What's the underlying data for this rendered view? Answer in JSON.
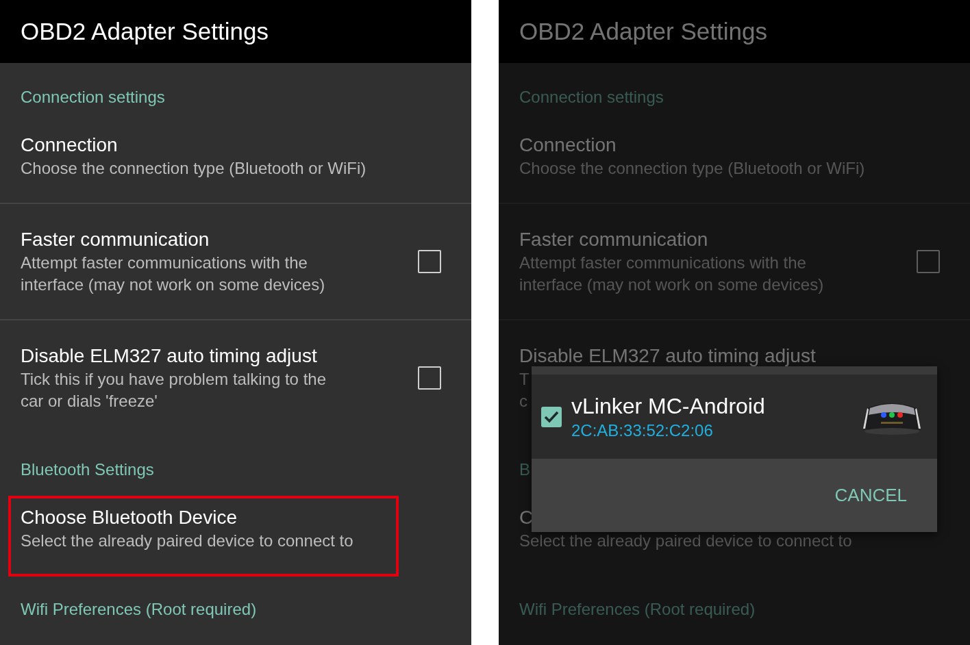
{
  "screens": [
    {
      "app_bar": {
        "title": "OBD2 Adapter Settings"
      },
      "dimmed": false,
      "sections": [
        {
          "header": "Connection settings",
          "items": [
            {
              "kind": "text",
              "title": "Connection",
              "summary": [
                "Choose the connection type (Bluetooth or WiFi)"
              ],
              "highlighted": false
            },
            {
              "kind": "checkbox",
              "title": "Faster communication",
              "summary": [
                "Attempt faster communications with the",
                "interface (may not work on some devices)"
              ],
              "checked": false,
              "highlighted": false
            },
            {
              "kind": "checkbox",
              "title": "Disable ELM327 auto timing adjust",
              "summary": [
                "Tick this if you have problem talking to the",
                "car or dials 'freeze'"
              ],
              "checked": false,
              "highlighted": false
            }
          ]
        },
        {
          "header": "Bluetooth Settings",
          "items": [
            {
              "kind": "text",
              "title": "Choose Bluetooth Device",
              "summary": [
                "Select the already paired device to connect to"
              ],
              "highlighted": true
            }
          ]
        },
        {
          "header": "Wifi Preferences (Root required)"
        }
      ]
    },
    {
      "app_bar": {
        "title": "OBD2 Adapter Settings"
      },
      "dimmed": true,
      "sections": [
        {
          "header": "Connection settings",
          "items": [
            {
              "kind": "text",
              "title": "Connection",
              "summary": [
                "Choose the connection type (Bluetooth or WiFi)"
              ],
              "highlighted": false
            },
            {
              "kind": "checkbox",
              "title": "Faster communication",
              "summary": [
                "Attempt faster communications with the",
                "interface (may not work on some devices)"
              ],
              "checked": false,
              "highlighted": false
            },
            {
              "kind": "text",
              "title": "Disable ELM327 auto timing adjust",
              "summary": [
                "T",
                "c"
              ],
              "highlighted": false
            }
          ]
        },
        {
          "header": "B",
          "items": [
            {
              "kind": "text",
              "title": "C",
              "summary": [
                "Select the already paired device to connect to"
              ],
              "highlighted": false
            }
          ]
        },
        {
          "header": "Wifi Preferences (Root required)"
        }
      ],
      "dialog": {
        "device": {
          "name": "vLinker MC-Android",
          "address": "2C:AB:33:52:C2:06",
          "checked": true,
          "kind": "picture"
        },
        "button": "CANCEL"
      }
    }
  ]
}
